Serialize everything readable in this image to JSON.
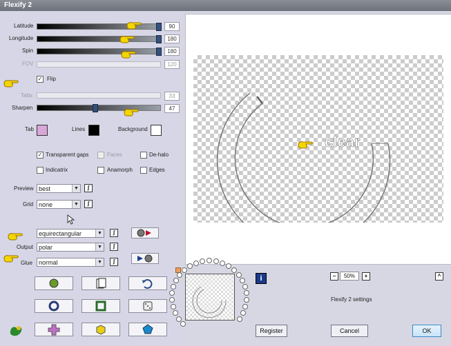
{
  "window": {
    "title": "Flexify 2"
  },
  "sliders": [
    {
      "label": "Latitude",
      "value": "90",
      "level": 1.0,
      "enabled": true
    },
    {
      "label": "Longitude",
      "value": "180",
      "level": 1.0,
      "enabled": true
    },
    {
      "label": "Spin",
      "value": "180",
      "level": 1.0,
      "enabled": true
    },
    {
      "label": "FOV",
      "value": "120",
      "level": 0.0,
      "enabled": false
    },
    {
      "label": "Tabs",
      "value": "33",
      "level": 0.0,
      "enabled": false
    },
    {
      "label": "Sharpen",
      "value": "47",
      "level": 0.47,
      "enabled": true
    }
  ],
  "flip": {
    "label": "Flip",
    "checked": true
  },
  "colors": {
    "tab_label": "Tab",
    "tab_color": "#d8a8d8",
    "lines_label": "Lines",
    "lines_color": "#000000",
    "background_label": "Background",
    "background_color": "#ffffff"
  },
  "options": [
    {
      "label": "Transparent gaps",
      "checked": true,
      "enabled": true
    },
    {
      "label": "Faces",
      "checked": false,
      "enabled": false
    },
    {
      "label": "De-halo",
      "checked": false,
      "enabled": true
    },
    {
      "label": "Indicatrix",
      "checked": false,
      "enabled": true
    },
    {
      "label": "Anamorph",
      "checked": false,
      "enabled": true
    },
    {
      "label": "Edges",
      "checked": false,
      "enabled": true
    }
  ],
  "preview_select": {
    "label": "Preview",
    "value": "best"
  },
  "grid_select": {
    "label": "Grid",
    "value": "none"
  },
  "input_select": {
    "label": "",
    "value": "equirectangular"
  },
  "output_select": {
    "label": "Output",
    "value": "polar"
  },
  "glue_select": {
    "label": "Glue",
    "value": "normal"
  },
  "preview_area": {
    "overlay_text": "clear"
  },
  "zoom": {
    "value": "50%",
    "minus": "−",
    "plus": "+"
  },
  "footer": {
    "settings_label": "Flexify 2 settings",
    "register_label": "Register",
    "cancel_label": "Cancel",
    "ok_label": "OK",
    "info_icon": "i",
    "collapse_icon": "^"
  },
  "accent": {
    "hand_pointer": "#f2d600",
    "ok_border": "#3a86c8"
  }
}
